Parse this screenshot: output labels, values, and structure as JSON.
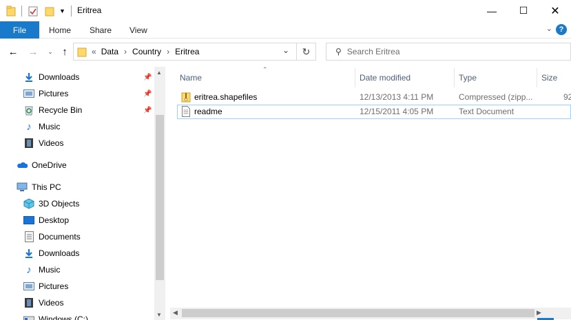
{
  "window": {
    "title": "Eritrea"
  },
  "ribbon": {
    "file_tab": "File",
    "tabs": [
      "Home",
      "Share",
      "View"
    ],
    "help": "?"
  },
  "address": {
    "overflow": "«",
    "crumbs": [
      "Data",
      "Country",
      "Eritrea"
    ],
    "separator": "›"
  },
  "search": {
    "placeholder": "Search Eritrea"
  },
  "nav": {
    "quick_access": [
      {
        "label": "Downloads",
        "icon": "download-icon",
        "pinned": true
      },
      {
        "label": "Pictures",
        "icon": "pictures-icon",
        "pinned": true
      },
      {
        "label": "Recycle Bin",
        "icon": "recycle-bin-icon",
        "pinned": true
      },
      {
        "label": "Music",
        "icon": "music-icon",
        "pinned": false
      },
      {
        "label": "Videos",
        "icon": "videos-icon",
        "pinned": false
      }
    ],
    "onedrive": "OneDrive",
    "this_pc": "This PC",
    "pc_items": [
      {
        "label": "3D Objects",
        "icon": "3d-objects-icon"
      },
      {
        "label": "Desktop",
        "icon": "desktop-icon"
      },
      {
        "label": "Documents",
        "icon": "documents-icon"
      },
      {
        "label": "Downloads",
        "icon": "download-icon"
      },
      {
        "label": "Music",
        "icon": "music-icon"
      },
      {
        "label": "Pictures",
        "icon": "pictures-icon"
      },
      {
        "label": "Videos",
        "icon": "videos-icon"
      },
      {
        "label": "Windows (C:)",
        "icon": "drive-icon"
      }
    ]
  },
  "columns": {
    "name": "Name",
    "date": "Date modified",
    "type": "Type",
    "size": "Size"
  },
  "files": [
    {
      "name": "eritrea.shapefiles",
      "date": "12/13/2013 4:11 PM",
      "type": "Compressed (zipp...",
      "size": "92",
      "icon": "zip-folder-icon"
    },
    {
      "name": "readme",
      "date": "12/15/2011 4:05 PM",
      "type": "Text Document",
      "size": "",
      "icon": "text-document-icon"
    }
  ],
  "colors": {
    "accent": "#1979ca",
    "folder": "#ffd86b",
    "header_text": "#4c607a",
    "selection_border": "#99d1ff"
  }
}
